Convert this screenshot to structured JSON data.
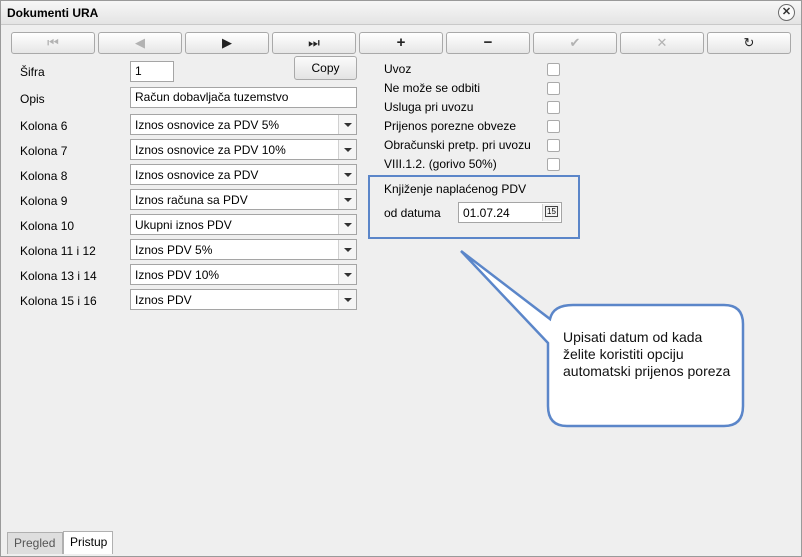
{
  "window": {
    "title": "Dokumenti URA",
    "close_symbol": "✕"
  },
  "toolbar": {
    "buttons": [
      {
        "name": "first-record-button",
        "symbol": "⏮",
        "disabled": true
      },
      {
        "name": "prev-record-button",
        "symbol": "◀",
        "disabled": true
      },
      {
        "name": "next-record-button",
        "symbol": "▶",
        "disabled": false
      },
      {
        "name": "last-record-button",
        "symbol": "⏭",
        "disabled": false
      },
      {
        "name": "add-button",
        "symbol": "+",
        "disabled": false
      },
      {
        "name": "delete-button",
        "symbol": "−",
        "disabled": false
      },
      {
        "name": "confirm-button",
        "symbol": "✔",
        "disabled": true
      },
      {
        "name": "cancel-button",
        "symbol": "✕",
        "disabled": true
      },
      {
        "name": "refresh-button",
        "symbol": "↻",
        "disabled": false
      }
    ]
  },
  "form": {
    "sifra": {
      "label": "Šifra",
      "value": "1"
    },
    "copy_label": "Copy",
    "opis": {
      "label": "Opis",
      "value": "Račun dobavljača tuzemstvo"
    },
    "columns": [
      {
        "label": "Kolona 6",
        "value": "Iznos osnovice za PDV 5%"
      },
      {
        "label": "Kolona 7",
        "value": "Iznos osnovice za PDV 10%"
      },
      {
        "label": "Kolona 8",
        "value": "Iznos osnovice za PDV"
      },
      {
        "label": "Kolona 9",
        "value": "Iznos računa sa PDV"
      },
      {
        "label": "Kolona 10",
        "value": "Ukupni iznos PDV"
      },
      {
        "label": "Kolona 11 i 12",
        "value": "Iznos PDV 5%"
      },
      {
        "label": "Kolona 13 i 14",
        "value": "Iznos PDV 10%"
      },
      {
        "label": "Kolona 15 i 16",
        "value": "Iznos PDV"
      }
    ],
    "checkboxes": [
      {
        "label": "Uvoz",
        "checked": false
      },
      {
        "label": "Ne može se odbiti",
        "checked": false
      },
      {
        "label": "Usluga pri uvozu",
        "checked": false
      },
      {
        "label": "Prijenos porezne obveze",
        "checked": false
      },
      {
        "label": "Obračunski pretp. pri uvozu",
        "checked": false
      },
      {
        "label": "VIII.1.2. (gorivo 50%)",
        "checked": false
      }
    ],
    "knjizenje": {
      "title": "Knjiženje naplaćenog PDV",
      "date_label": "od datuma",
      "date_value": "01.07.24",
      "calendar_glyph": "15"
    }
  },
  "callout": {
    "text": "Upisati datum od kada želite koristiti opciju automatski prijenos poreza",
    "border_color": "#5b86c9"
  },
  "tabs": [
    {
      "label": "Pregled",
      "active": false
    },
    {
      "label": "Pristup",
      "active": true
    }
  ]
}
